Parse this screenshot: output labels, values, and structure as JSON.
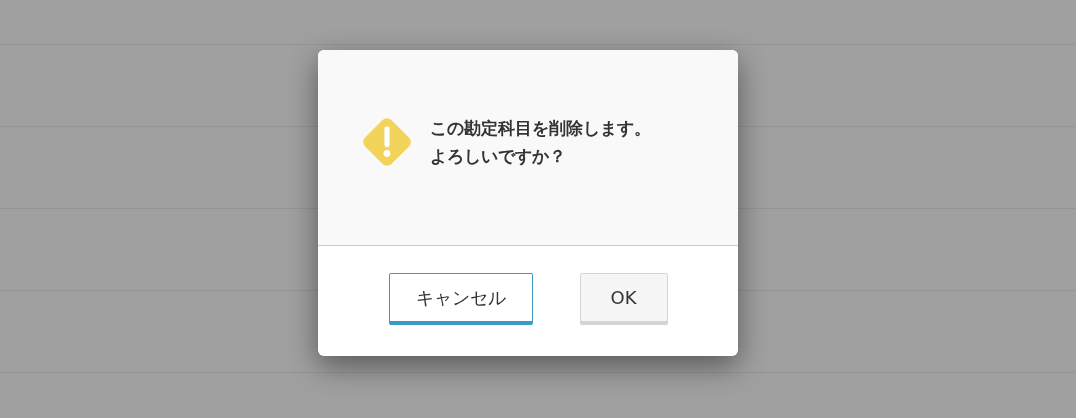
{
  "dialog": {
    "message_lines": [
      "この勘定科目を削除します。",
      "よろしいですか？"
    ],
    "buttons": [
      {
        "label": "キャンセル",
        "focused": true
      },
      {
        "label": "OK",
        "focused": false
      }
    ]
  }
}
